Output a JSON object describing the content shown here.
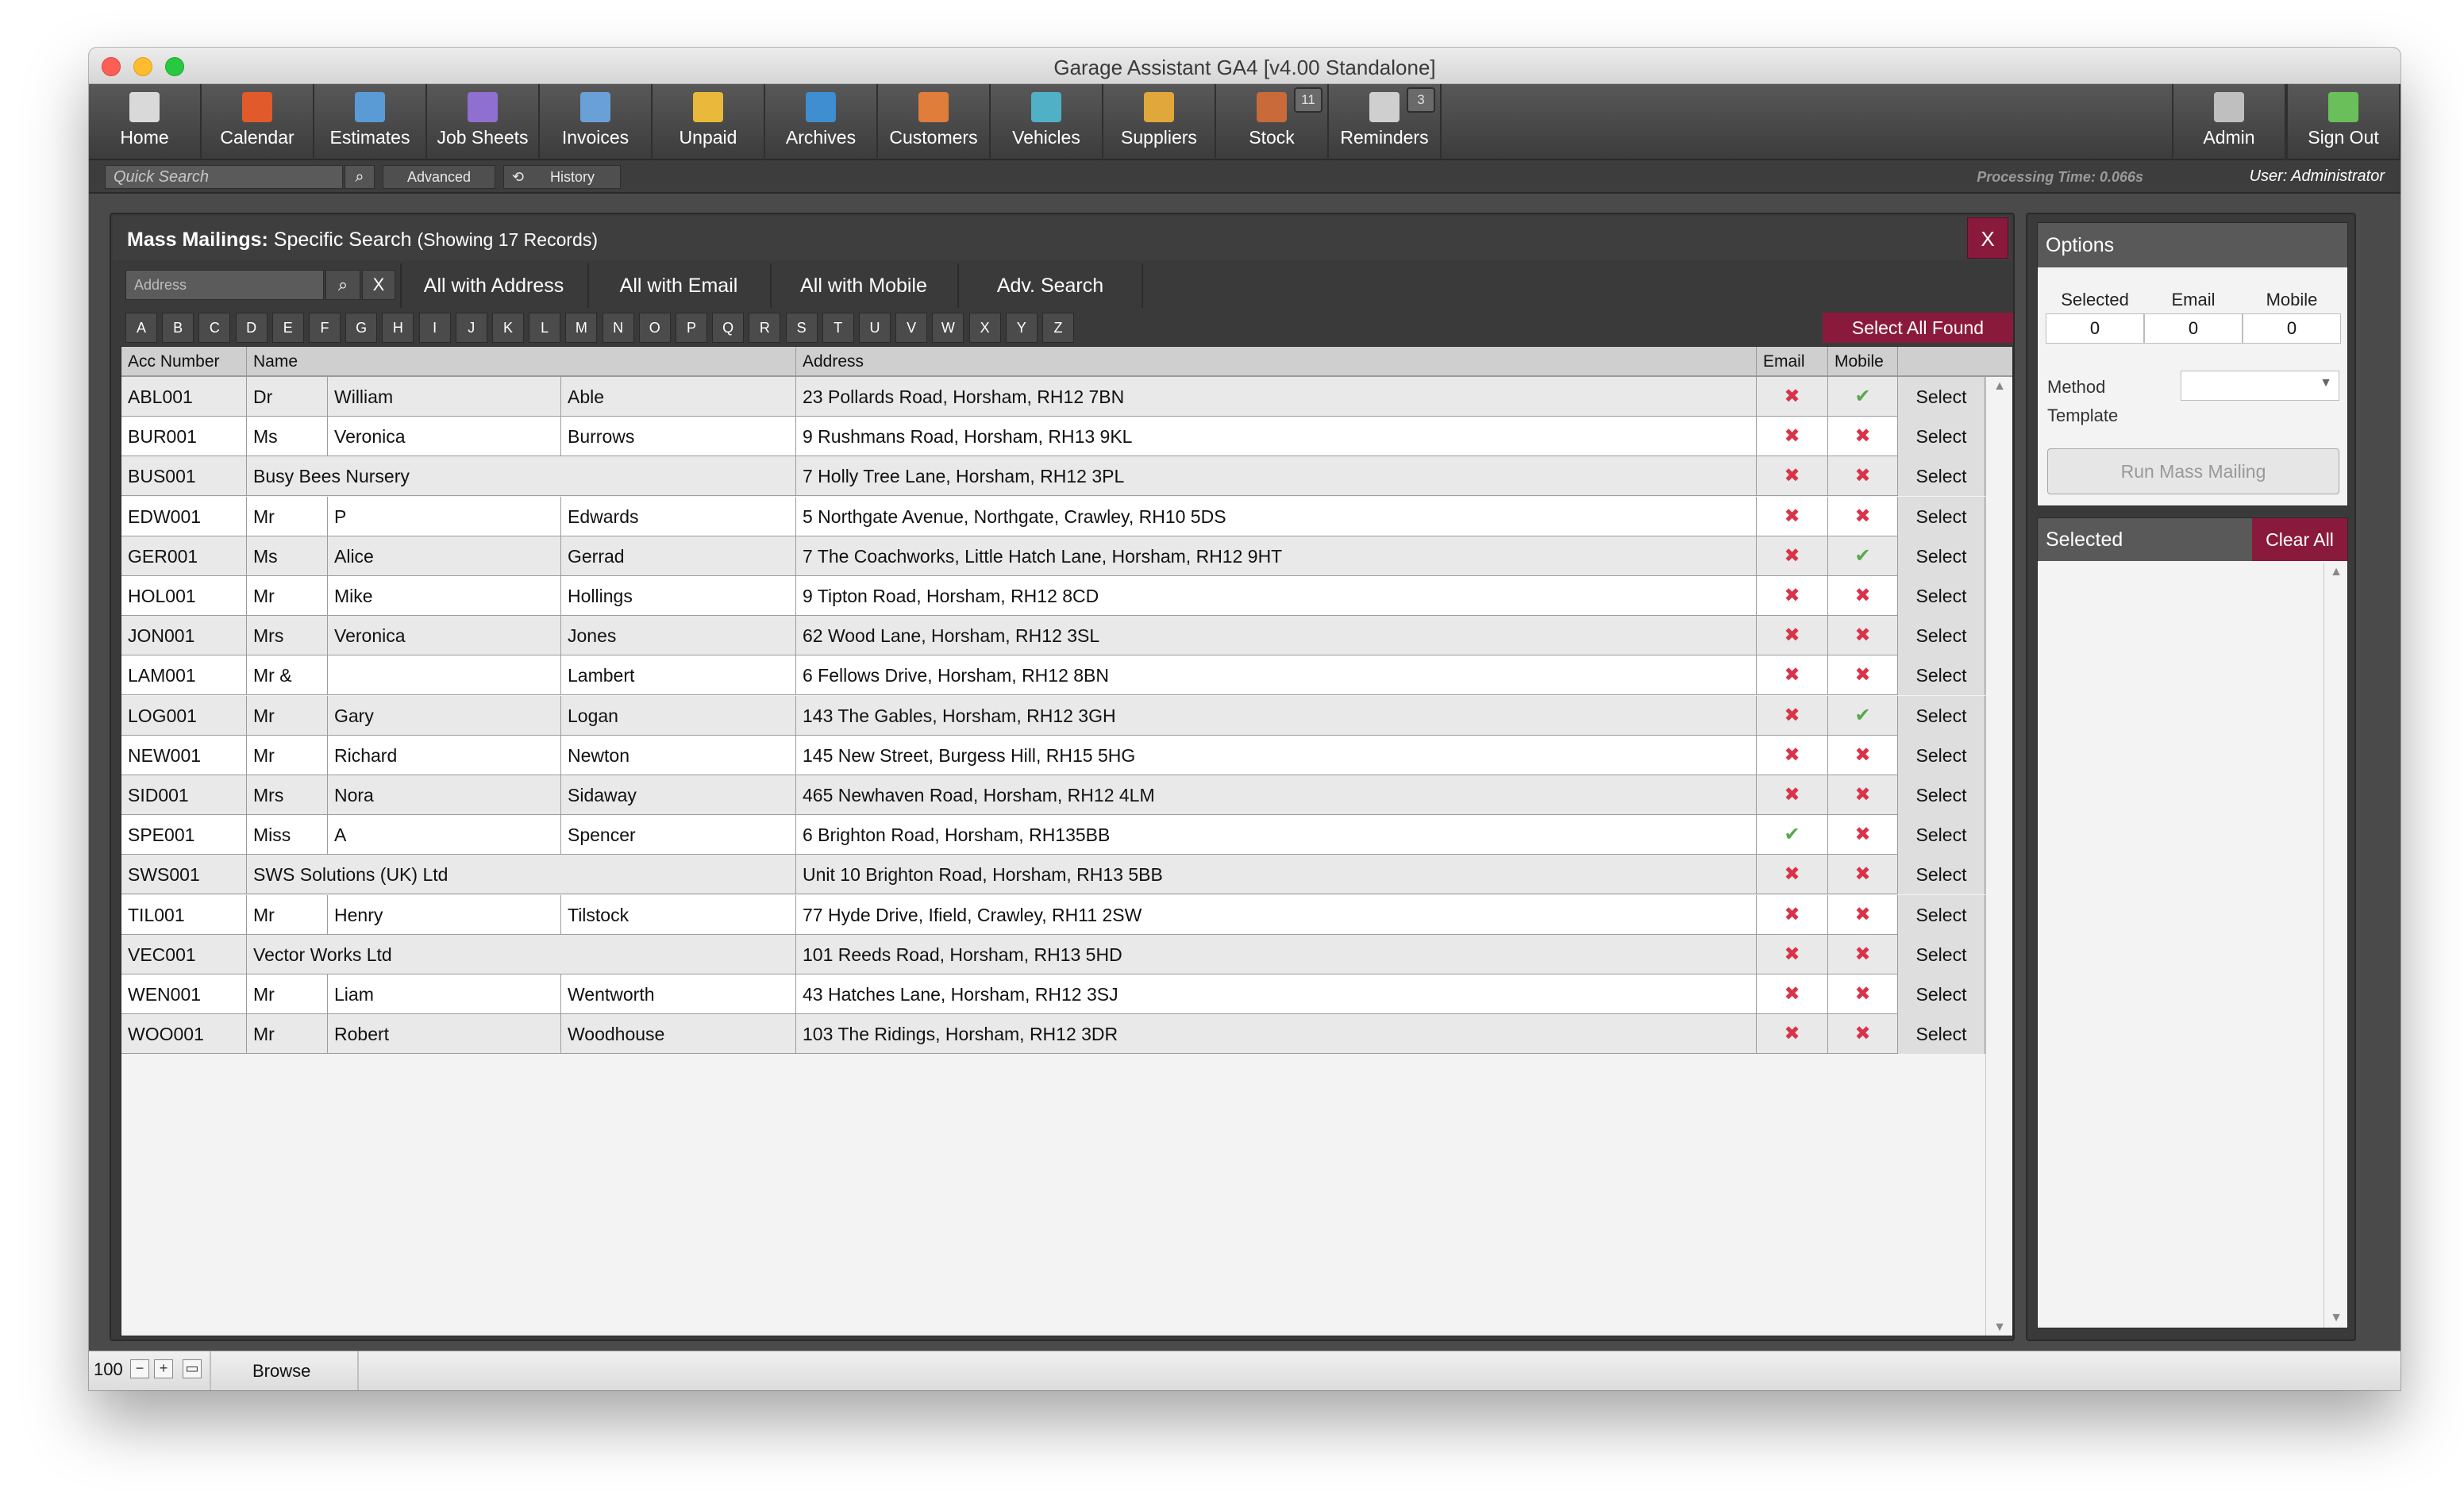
{
  "window": {
    "title": "Garage Assistant GA4 [v4.00 Standalone]"
  },
  "toolbar": {
    "items": [
      {
        "label": "Home",
        "icon": "home-icon"
      },
      {
        "label": "Calendar",
        "icon": "calendar-icon"
      },
      {
        "label": "Estimates",
        "icon": "estimates-icon"
      },
      {
        "label": "Job Sheets",
        "icon": "job-sheets-icon"
      },
      {
        "label": "Invoices",
        "icon": "invoices-icon"
      },
      {
        "label": "Unpaid",
        "icon": "unpaid-icon"
      },
      {
        "label": "Archives",
        "icon": "archives-icon"
      },
      {
        "label": "Customers",
        "icon": "customers-icon"
      },
      {
        "label": "Vehicles",
        "icon": "vehicles-icon"
      },
      {
        "label": "Suppliers",
        "icon": "suppliers-icon"
      },
      {
        "label": "Stock",
        "icon": "stock-icon",
        "badge": "11"
      },
      {
        "label": "Reminders",
        "icon": "reminders-icon",
        "badge": "3"
      }
    ],
    "right_items": [
      {
        "label": "Admin",
        "icon": "admin-tools-icon"
      },
      {
        "label": "Sign Out",
        "icon": "sign-out-icon"
      }
    ]
  },
  "search_bar": {
    "quick_search_placeholder": "Quick Search",
    "advanced_label": "Advanced",
    "history_label": "History",
    "processing_time": "Processing Time: 0.066s",
    "user": "User: Administrator"
  },
  "panel": {
    "title_bold": "Mass Mailings:",
    "title_rest": "Specific Search",
    "record_count": "(Showing 17 Records)",
    "close_label": "X",
    "filter_placeholder": "Address",
    "filter_clear": "X",
    "quick_filters": [
      "All with Address",
      "All with Email",
      "All with Mobile",
      "Adv. Search"
    ],
    "alphabet": [
      "A",
      "B",
      "C",
      "D",
      "E",
      "F",
      "G",
      "H",
      "I",
      "J",
      "K",
      "L",
      "M",
      "N",
      "O",
      "P",
      "Q",
      "R",
      "S",
      "T",
      "U",
      "V",
      "W",
      "X",
      "Y",
      "Z"
    ],
    "select_all_found": "Select All Found"
  },
  "table": {
    "headers": {
      "acc": "Acc Number",
      "name": "Name",
      "address": "Address",
      "email": "Email",
      "mobile": "Mobile"
    },
    "select_label": "Select",
    "rows": [
      {
        "acc": "ABL001",
        "title": "Dr",
        "first": "William",
        "last": "Able",
        "address": "23 Pollards Road, Horsham, RH12 7BN",
        "email": false,
        "mobile": true
      },
      {
        "acc": "BUR001",
        "title": "Ms",
        "first": "Veronica",
        "last": "Burrows",
        "address": "9 Rushmans Road, Horsham, RH13 9KL",
        "email": false,
        "mobile": false
      },
      {
        "acc": "BUS001",
        "company": "Busy Bees Nursery",
        "address": "7 Holly Tree Lane, Horsham, RH12 3PL",
        "email": false,
        "mobile": false
      },
      {
        "acc": "EDW001",
        "title": "Mr",
        "first": "P",
        "last": "Edwards",
        "address": "5 Northgate Avenue, Northgate, Crawley, RH10 5DS",
        "email": false,
        "mobile": false
      },
      {
        "acc": "GER001",
        "title": "Ms",
        "first": "Alice",
        "last": "Gerrad",
        "address": "7 The Coachworks, Little Hatch Lane, Horsham, RH12 9HT",
        "email": false,
        "mobile": true
      },
      {
        "acc": "HOL001",
        "title": "Mr",
        "first": "Mike",
        "last": "Hollings",
        "address": "9 Tipton Road, Horsham, RH12 8CD",
        "email": false,
        "mobile": false
      },
      {
        "acc": "JON001",
        "title": "Mrs",
        "first": "Veronica",
        "last": "Jones",
        "address": "62 Wood Lane, Horsham, RH12 3SL",
        "email": false,
        "mobile": false
      },
      {
        "acc": "LAM001",
        "title": "Mr &",
        "first": "",
        "last": "Lambert",
        "address": "6 Fellows Drive, Horsham, RH12 8BN",
        "email": false,
        "mobile": false
      },
      {
        "acc": "LOG001",
        "title": "Mr",
        "first": "Gary",
        "last": "Logan",
        "address": "143 The Gables, Horsham, RH12 3GH",
        "email": false,
        "mobile": true
      },
      {
        "acc": "NEW001",
        "title": "Mr",
        "first": "Richard",
        "last": "Newton",
        "address": "145 New Street, Burgess Hill, RH15 5HG",
        "email": false,
        "mobile": false
      },
      {
        "acc": "SID001",
        "title": "Mrs",
        "first": "Nora",
        "last": "Sidaway",
        "address": "465 Newhaven Road, Horsham, RH12 4LM",
        "email": false,
        "mobile": false
      },
      {
        "acc": "SPE001",
        "title": "Miss",
        "first": "A",
        "last": "Spencer",
        "address": "6 Brighton Road, Horsham, RH135BB",
        "email": true,
        "mobile": false
      },
      {
        "acc": "SWS001",
        "company": "SWS Solutions (UK) Ltd",
        "address": "Unit 10 Brighton Road, Horsham, RH13 5BB",
        "email": false,
        "mobile": false
      },
      {
        "acc": "TIL001",
        "title": "Mr",
        "first": "Henry",
        "last": "Tilstock",
        "address": "77 Hyde Drive, Ifield, Crawley, RH11 2SW",
        "email": false,
        "mobile": false
      },
      {
        "acc": "VEC001",
        "company": "Vector Works Ltd",
        "address": "101 Reeds Road, Horsham, RH13 5HD",
        "email": false,
        "mobile": false
      },
      {
        "acc": "WEN001",
        "title": "Mr",
        "first": "Liam",
        "last": "Wentworth",
        "address": "43 Hatches Lane, Horsham, RH12 3SJ",
        "email": false,
        "mobile": false
      },
      {
        "acc": "WOO001",
        "title": "Mr",
        "first": "Robert",
        "last": "Woodhouse",
        "address": "103 The Ridings, Horsham, RH12 3DR",
        "email": false,
        "mobile": false
      }
    ]
  },
  "options": {
    "title": "Options",
    "selected_label": "Selected",
    "email_label": "Email",
    "mobile_label": "Mobile",
    "selected_count": "0",
    "email_count": "0",
    "mobile_count": "0",
    "method_label": "Method",
    "template_label": "Template",
    "run_label": "Run Mass Mailing"
  },
  "selected_panel": {
    "title": "Selected",
    "clear_all": "Clear All"
  },
  "status_bar": {
    "zoom": "100",
    "mode": "Browse"
  },
  "colors": {
    "accent": "#8a1a3c",
    "check": "#57a94a",
    "cross": "#d9334a"
  }
}
